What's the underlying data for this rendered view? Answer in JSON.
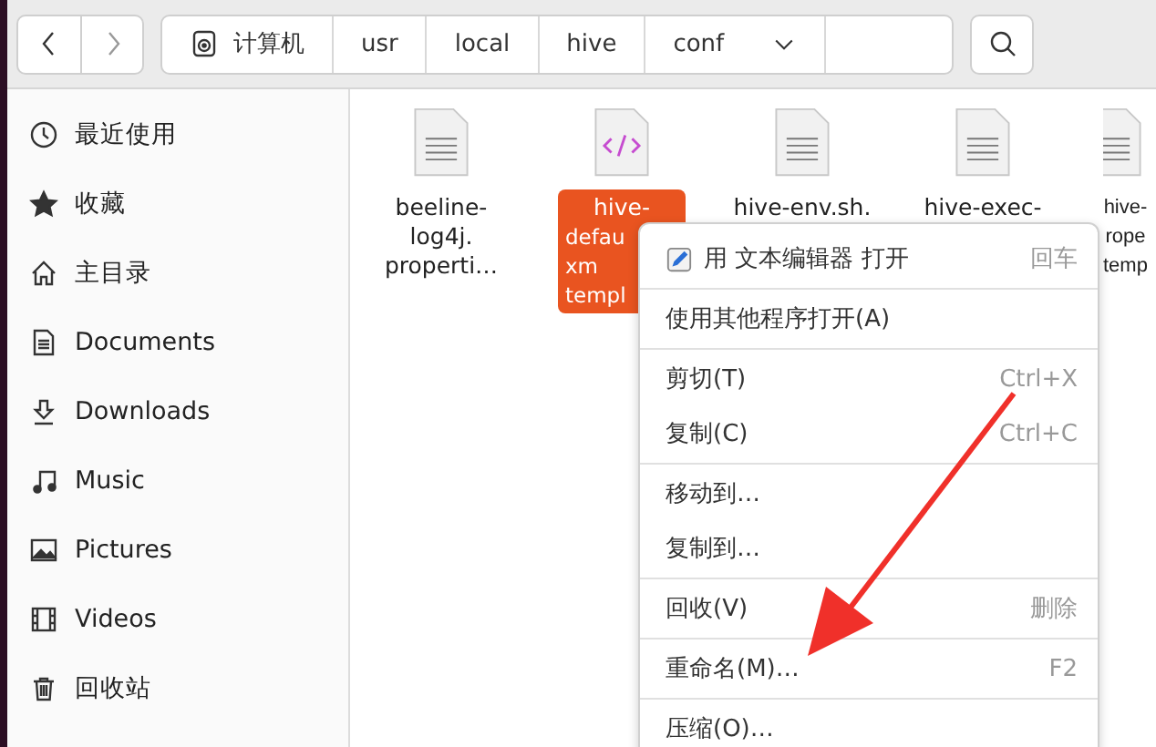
{
  "path_bar": {
    "segments": [
      {
        "label": "计算机",
        "kind": "root"
      },
      {
        "label": "usr",
        "kind": "folder"
      },
      {
        "label": "local",
        "kind": "folder"
      },
      {
        "label": "hive",
        "kind": "folder"
      },
      {
        "label": "conf",
        "kind": "current"
      }
    ]
  },
  "sidebar": {
    "items": [
      {
        "label": "最近使用"
      },
      {
        "label": "收藏"
      },
      {
        "label": "主目录"
      },
      {
        "label": "Documents"
      },
      {
        "label": "Downloads"
      },
      {
        "label": "Music"
      },
      {
        "label": "Pictures"
      },
      {
        "label": "Videos"
      },
      {
        "label": "回收站"
      }
    ]
  },
  "files": [
    {
      "lines": [
        "beeline-",
        "log4j.",
        "properti…"
      ],
      "kind": "text",
      "selected": false
    },
    {
      "lines": [
        "hive-",
        "defau",
        "xm",
        "templ"
      ],
      "kind": "xml",
      "selected": true
    },
    {
      "lines": [
        "hive-env.sh."
      ],
      "kind": "text",
      "selected": false
    },
    {
      "lines": [
        "hive-exec-"
      ],
      "kind": "text",
      "selected": false
    },
    {
      "lines": [
        "hive-",
        "rope",
        "temp"
      ],
      "kind": "text",
      "selected": false
    }
  ],
  "context_menu": {
    "groups": [
      [
        {
          "label": "用 文本编辑器 打开",
          "shortcut": "回车",
          "kind": "editor"
        }
      ],
      [
        {
          "label": "使用其他程序打开(A)",
          "kind": "plain"
        }
      ],
      [
        {
          "label": "剪切(T)",
          "shortcut": "Ctrl+X",
          "kind": "plain"
        },
        {
          "label": "复制(C)",
          "shortcut": "Ctrl+C",
          "kind": "plain"
        }
      ],
      [
        {
          "label": "移动到…",
          "kind": "plain"
        },
        {
          "label": "复制到…",
          "kind": "plain"
        }
      ],
      [
        {
          "label": "回收(V)",
          "shortcut": "删除",
          "kind": "plain"
        }
      ],
      [
        {
          "label": "重命名(M)…",
          "shortcut": "F2",
          "kind": "plain"
        }
      ],
      [
        {
          "label": "压缩(O)…",
          "kind": "plain"
        }
      ]
    ]
  }
}
